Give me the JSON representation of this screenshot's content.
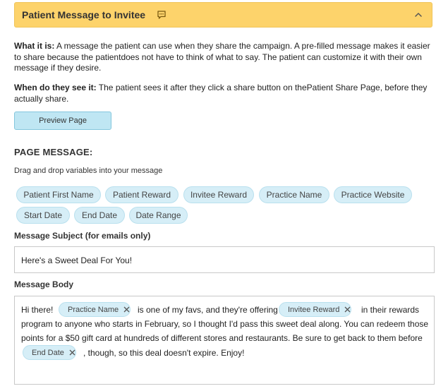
{
  "header": {
    "title": "Patient Message to Invitee",
    "icon": "chat-icon",
    "collapse_icon": "chevron-up-icon",
    "bg_color": "#fdd36b"
  },
  "info": {
    "what_label": "What it is:",
    "what_text": " A message the patient can use when they share the campaign. A pre-filled message makes it easier to share because the patientdoes not have to think of what to say. The patient can customize it with their own message if they desire.",
    "when_label": "When do they see it:",
    "when_text": " The patient sees it after they click a share button on thePatient Share Page, before they actually share."
  },
  "preview_button": "Preview Page",
  "page_message": {
    "heading": "PAGE MESSAGE:",
    "help": "Drag and drop variables into your message",
    "variables": [
      "Patient First Name",
      "Patient Reward",
      "Invitee Reward",
      "Practice Name",
      "Practice Website",
      "Start Date",
      "End Date",
      "Date Range"
    ]
  },
  "subject": {
    "label": "Message Subject (for emails only)",
    "value": "Here's a Sweet Deal For You!"
  },
  "body": {
    "label": "Message Body",
    "seg1": "Hi there!",
    "chip1": "Practice Name",
    "seg2": "is one of my favs, and they're offering",
    "chip2": "Invitee Reward",
    "seg3": "in their rewards",
    "line2": "program to anyone who starts in February, so I thought I'd pass this sweet deal along. You can redeem those",
    "line3": "points for a $50 gift card at hundreds of different stores and restaurants. Be sure to get back to them before",
    "chip3": "End Date",
    "seg4": ", though, so this deal doesn't expire. Enjoy!"
  },
  "colors": {
    "chip_bg": "#d6eef7",
    "button_bg": "#bfe6f3"
  }
}
